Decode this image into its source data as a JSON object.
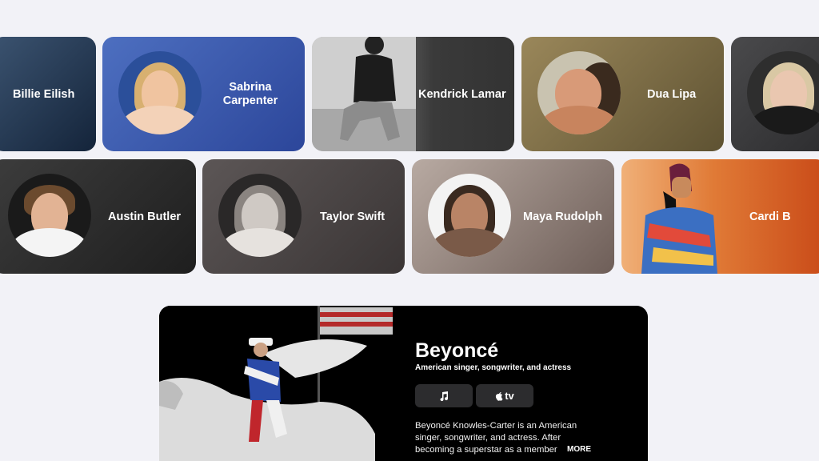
{
  "artists_row1": [
    {
      "name": "Billie Eilish",
      "bg": "#1e3550"
    },
    {
      "name": "Sabrina Carpenter",
      "bg": "#3a58a8"
    },
    {
      "name": "Kendrick Lamar",
      "bg": "#3a3a3a"
    },
    {
      "name": "Dua Lipa",
      "bg": "#7c6b45"
    },
    {
      "name": "",
      "bg": "#3a3a3c"
    }
  ],
  "artists_row2": [
    {
      "name": "Austin Butler",
      "bg": "#2a2a2a"
    },
    {
      "name": "Taylor Swift",
      "bg": "#4a4545"
    },
    {
      "name": "Maya Rudolph",
      "bg": "#9a8a82"
    },
    {
      "name": "Cardi B",
      "bg": "#d06a2c"
    }
  ],
  "featured": {
    "title": "Beyoncé",
    "subtitle": "American singer, songwriter, and actress",
    "music_button_icon": "music-note-icon",
    "tv_button_label": "tv",
    "description": "Beyoncé Knowles-Carter is an American singer, songwriter, and actress. After becoming a superstar as a member",
    "more_label": "MORE"
  }
}
